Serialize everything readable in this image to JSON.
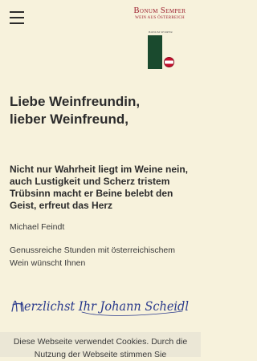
{
  "header": {
    "logo_title": "Bonum Semper",
    "logo_subtitle": "WEIN AUS ÖSTERREICH",
    "bottle_label": "BONUM SEMPER"
  },
  "main": {
    "headline_line1": "Liebe Weinfreundin,",
    "headline_line2": "lieber Weinfreund,",
    "quote": "Nicht nur Wahrheit liegt im Weine nein, auch Lustigkeit und Scherz tristem Trübsinn macht er Beine belebt den Geist, erfreut das Herz",
    "author": "Michael Feindt",
    "message": "Genussreiche Stunden mit österreichischem Wein wünscht Ihnen",
    "signature": "Herzlichst Ihr Johann Scheidl"
  },
  "cookie_banner": {
    "text": "Diese Webseite verwendet Cookies. Durch die Nutzung der Webseite stimmen Sie"
  },
  "colors": {
    "background": "#f7f2dc",
    "brand": "#9b1c2c",
    "bottle": "#1a4a2e",
    "signature": "#2a3a8c"
  }
}
